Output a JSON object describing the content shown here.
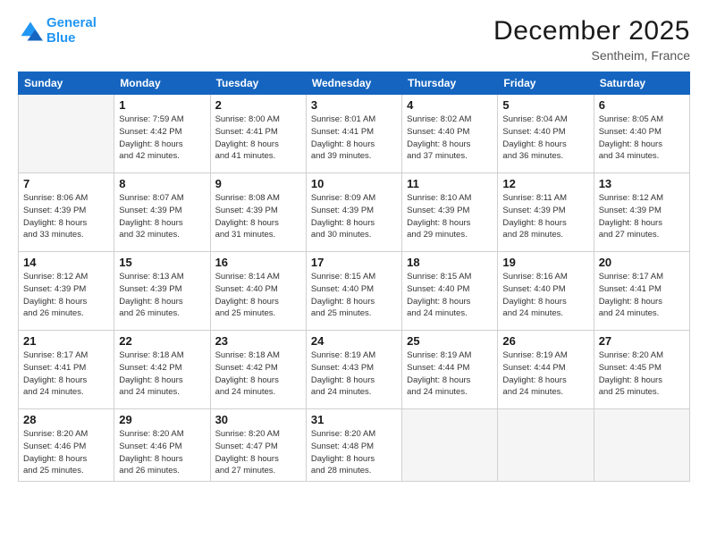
{
  "logo": {
    "line1": "General",
    "line2": "Blue"
  },
  "title": "December 2025",
  "subtitle": "Sentheim, France",
  "weekdays": [
    "Sunday",
    "Monday",
    "Tuesday",
    "Wednesday",
    "Thursday",
    "Friday",
    "Saturday"
  ],
  "weeks": [
    [
      {
        "day": "",
        "info": ""
      },
      {
        "day": "1",
        "info": "Sunrise: 7:59 AM\nSunset: 4:42 PM\nDaylight: 8 hours\nand 42 minutes."
      },
      {
        "day": "2",
        "info": "Sunrise: 8:00 AM\nSunset: 4:41 PM\nDaylight: 8 hours\nand 41 minutes."
      },
      {
        "day": "3",
        "info": "Sunrise: 8:01 AM\nSunset: 4:41 PM\nDaylight: 8 hours\nand 39 minutes."
      },
      {
        "day": "4",
        "info": "Sunrise: 8:02 AM\nSunset: 4:40 PM\nDaylight: 8 hours\nand 37 minutes."
      },
      {
        "day": "5",
        "info": "Sunrise: 8:04 AM\nSunset: 4:40 PM\nDaylight: 8 hours\nand 36 minutes."
      },
      {
        "day": "6",
        "info": "Sunrise: 8:05 AM\nSunset: 4:40 PM\nDaylight: 8 hours\nand 34 minutes."
      }
    ],
    [
      {
        "day": "7",
        "info": "Sunrise: 8:06 AM\nSunset: 4:39 PM\nDaylight: 8 hours\nand 33 minutes."
      },
      {
        "day": "8",
        "info": "Sunrise: 8:07 AM\nSunset: 4:39 PM\nDaylight: 8 hours\nand 32 minutes."
      },
      {
        "day": "9",
        "info": "Sunrise: 8:08 AM\nSunset: 4:39 PM\nDaylight: 8 hours\nand 31 minutes."
      },
      {
        "day": "10",
        "info": "Sunrise: 8:09 AM\nSunset: 4:39 PM\nDaylight: 8 hours\nand 30 minutes."
      },
      {
        "day": "11",
        "info": "Sunrise: 8:10 AM\nSunset: 4:39 PM\nDaylight: 8 hours\nand 29 minutes."
      },
      {
        "day": "12",
        "info": "Sunrise: 8:11 AM\nSunset: 4:39 PM\nDaylight: 8 hours\nand 28 minutes."
      },
      {
        "day": "13",
        "info": "Sunrise: 8:12 AM\nSunset: 4:39 PM\nDaylight: 8 hours\nand 27 minutes."
      }
    ],
    [
      {
        "day": "14",
        "info": "Sunrise: 8:12 AM\nSunset: 4:39 PM\nDaylight: 8 hours\nand 26 minutes."
      },
      {
        "day": "15",
        "info": "Sunrise: 8:13 AM\nSunset: 4:39 PM\nDaylight: 8 hours\nand 26 minutes."
      },
      {
        "day": "16",
        "info": "Sunrise: 8:14 AM\nSunset: 4:40 PM\nDaylight: 8 hours\nand 25 minutes."
      },
      {
        "day": "17",
        "info": "Sunrise: 8:15 AM\nSunset: 4:40 PM\nDaylight: 8 hours\nand 25 minutes."
      },
      {
        "day": "18",
        "info": "Sunrise: 8:15 AM\nSunset: 4:40 PM\nDaylight: 8 hours\nand 24 minutes."
      },
      {
        "day": "19",
        "info": "Sunrise: 8:16 AM\nSunset: 4:40 PM\nDaylight: 8 hours\nand 24 minutes."
      },
      {
        "day": "20",
        "info": "Sunrise: 8:17 AM\nSunset: 4:41 PM\nDaylight: 8 hours\nand 24 minutes."
      }
    ],
    [
      {
        "day": "21",
        "info": "Sunrise: 8:17 AM\nSunset: 4:41 PM\nDaylight: 8 hours\nand 24 minutes."
      },
      {
        "day": "22",
        "info": "Sunrise: 8:18 AM\nSunset: 4:42 PM\nDaylight: 8 hours\nand 24 minutes."
      },
      {
        "day": "23",
        "info": "Sunrise: 8:18 AM\nSunset: 4:42 PM\nDaylight: 8 hours\nand 24 minutes."
      },
      {
        "day": "24",
        "info": "Sunrise: 8:19 AM\nSunset: 4:43 PM\nDaylight: 8 hours\nand 24 minutes."
      },
      {
        "day": "25",
        "info": "Sunrise: 8:19 AM\nSunset: 4:44 PM\nDaylight: 8 hours\nand 24 minutes."
      },
      {
        "day": "26",
        "info": "Sunrise: 8:19 AM\nSunset: 4:44 PM\nDaylight: 8 hours\nand 24 minutes."
      },
      {
        "day": "27",
        "info": "Sunrise: 8:20 AM\nSunset: 4:45 PM\nDaylight: 8 hours\nand 25 minutes."
      }
    ],
    [
      {
        "day": "28",
        "info": "Sunrise: 8:20 AM\nSunset: 4:46 PM\nDaylight: 8 hours\nand 25 minutes."
      },
      {
        "day": "29",
        "info": "Sunrise: 8:20 AM\nSunset: 4:46 PM\nDaylight: 8 hours\nand 26 minutes."
      },
      {
        "day": "30",
        "info": "Sunrise: 8:20 AM\nSunset: 4:47 PM\nDaylight: 8 hours\nand 27 minutes."
      },
      {
        "day": "31",
        "info": "Sunrise: 8:20 AM\nSunset: 4:48 PM\nDaylight: 8 hours\nand 28 minutes."
      },
      {
        "day": "",
        "info": ""
      },
      {
        "day": "",
        "info": ""
      },
      {
        "day": "",
        "info": ""
      }
    ]
  ]
}
